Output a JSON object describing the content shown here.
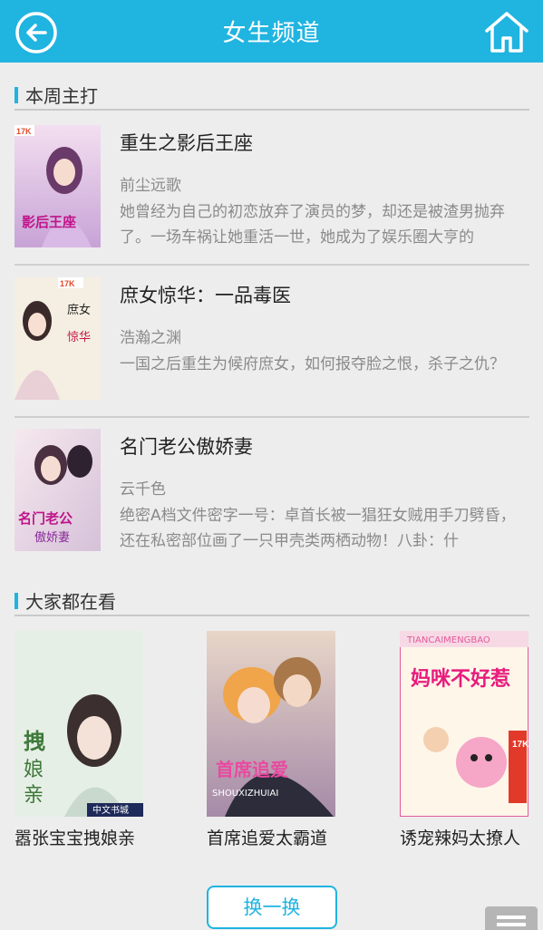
{
  "header": {
    "title": "女生频道",
    "back_icon": "back-arrow-icon",
    "home_icon": "home-icon"
  },
  "featured": {
    "section_title": "本周主打",
    "books": [
      {
        "title": "重生之影后王座",
        "author": "前尘远歌",
        "desc": "她曾经为自己的初恋放弃了演员的梦，却还是被渣男抛弃了。一场车祸让她重活一世，她成为了娱乐圈大亨的",
        "cover_text": "重生之 影后王座",
        "cover_badge": "17K"
      },
      {
        "title": "庶女惊华：一品毒医",
        "author": "浩瀚之渊",
        "desc": "一国之后重生为候府庶女，如何报夺脸之恨，杀子之仇？",
        "cover_text": "庶女惊华 一品毒医",
        "cover_badge": "17K"
      },
      {
        "title": "名门老公傲娇妻",
        "author": "云千色",
        "desc": "绝密A档文件密字一号：卓首长被一猖狂女贼用手刀劈昏，还在私密部位画了一只甲壳类两栖动物！八卦：什",
        "cover_text": "名门老公 傲娇妻",
        "cover_badge": ""
      }
    ]
  },
  "popular": {
    "section_title": "大家都在看",
    "books": [
      {
        "title": "嚣张宝宝拽娘亲",
        "cover_text": "嚣张宝宝 拽娘亲",
        "cover_badge": "中文书城"
      },
      {
        "title": "首席追爱太霸道",
        "cover_text": "首席追爱 太霸道",
        "cover_badge": "SHOUXIZHUIAI"
      },
      {
        "title": "诱宠辣妈太撩人",
        "cover_text": "妈咪不好惹",
        "cover_badge": "TIANCAIMENGBAO"
      }
    ]
  },
  "refresh_label": "换一换",
  "colors": {
    "accent": "#20b4e0",
    "background": "#ededed"
  }
}
